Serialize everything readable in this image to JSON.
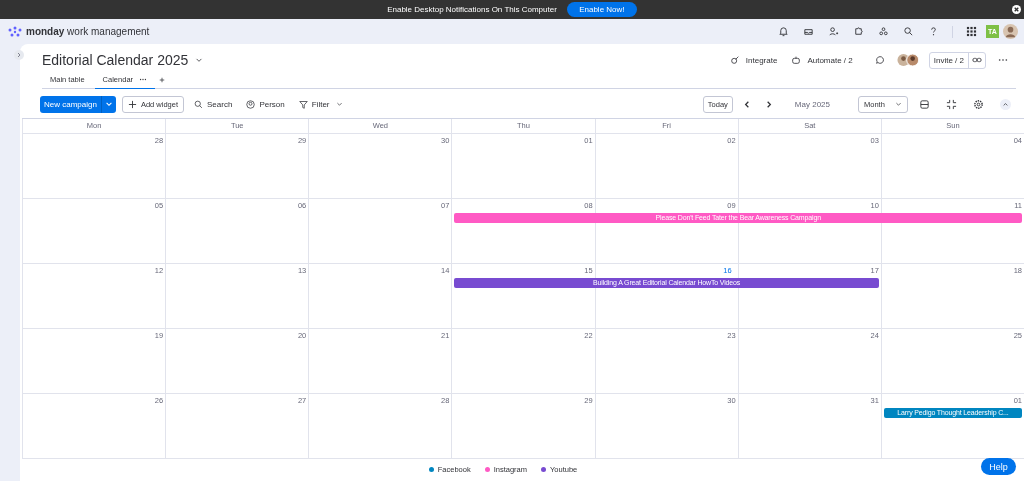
{
  "banner": {
    "text": "Enable Desktop Notifications On This Computer",
    "button": "Enable Now!"
  },
  "app_bar": {
    "brand": "monday",
    "product": "work management",
    "logo_badge": "TA"
  },
  "board": {
    "title": "Editorial Calendar 2025",
    "integrate": "Integrate",
    "automate": "Automate / 2",
    "invite": "Invite / 2"
  },
  "tabs": [
    {
      "label": "Main table",
      "selected": false
    },
    {
      "label": "Calendar",
      "selected": true
    }
  ],
  "toolbar": {
    "new_item": "New campaign",
    "add_widget": "Add widget",
    "search": "Search",
    "person": "Person",
    "filter": "Filter"
  },
  "calendar_nav": {
    "today": "Today",
    "period": "May 2025",
    "view": "Month"
  },
  "weekdays": [
    "Mon",
    "Tue",
    "Wed",
    "Thu",
    "Fri",
    "Sat",
    "Sun"
  ],
  "weeks": [
    {
      "days": [
        {
          "n": "28",
          "today": false
        },
        {
          "n": "29",
          "today": false
        },
        {
          "n": "30",
          "today": false
        },
        {
          "n": "01",
          "today": false
        },
        {
          "n": "02",
          "today": false
        },
        {
          "n": "03",
          "today": false
        },
        {
          "n": "04",
          "today": false
        }
      ]
    },
    {
      "days": [
        {
          "n": "05",
          "today": false
        },
        {
          "n": "06",
          "today": false
        },
        {
          "n": "07",
          "today": false
        },
        {
          "n": "08",
          "today": false,
          "event": {
            "title": "Please Don't Feed Tater the Bear Awareness Campaign",
            "color": "#ff5ac4"
          }
        },
        {
          "n": "09",
          "today": false,
          "continues": true
        },
        {
          "n": "10",
          "today": false,
          "continues": true
        },
        {
          "n": "11",
          "today": false,
          "continues": true
        }
      ]
    },
    {
      "days": [
        {
          "n": "12",
          "today": false
        },
        {
          "n": "13",
          "today": false
        },
        {
          "n": "14",
          "today": false
        },
        {
          "n": "15",
          "today": false,
          "event": {
            "title": "Building A Great Editorial Calendar HowTo Videos",
            "color": "#784bd1"
          }
        },
        {
          "n": "16",
          "today": true,
          "continues": true
        },
        {
          "n": "17",
          "today": false,
          "continues": true
        },
        {
          "n": "18",
          "today": false
        }
      ]
    },
    {
      "days": [
        {
          "n": "19",
          "today": false
        },
        {
          "n": "20",
          "today": false
        },
        {
          "n": "21",
          "today": false
        },
        {
          "n": "22",
          "today": false
        },
        {
          "n": "23",
          "today": false
        },
        {
          "n": "24",
          "today": false
        },
        {
          "n": "25",
          "today": false
        }
      ]
    },
    {
      "days": [
        {
          "n": "26",
          "today": false
        },
        {
          "n": "27",
          "today": false
        },
        {
          "n": "28",
          "today": false
        },
        {
          "n": "29",
          "today": false
        },
        {
          "n": "30",
          "today": false
        },
        {
          "n": "31",
          "today": false
        },
        {
          "n": "01",
          "today": false,
          "event": {
            "title": "Larry Pedigo Thought Leadership C...",
            "color": "#0086c0"
          }
        }
      ]
    }
  ],
  "legend": [
    {
      "label": "Facebook",
      "color": "#0086c0"
    },
    {
      "label": "Instagram",
      "color": "#ff5ac4"
    },
    {
      "label": "Youtube",
      "color": "#784bd1"
    }
  ],
  "help": "Help"
}
